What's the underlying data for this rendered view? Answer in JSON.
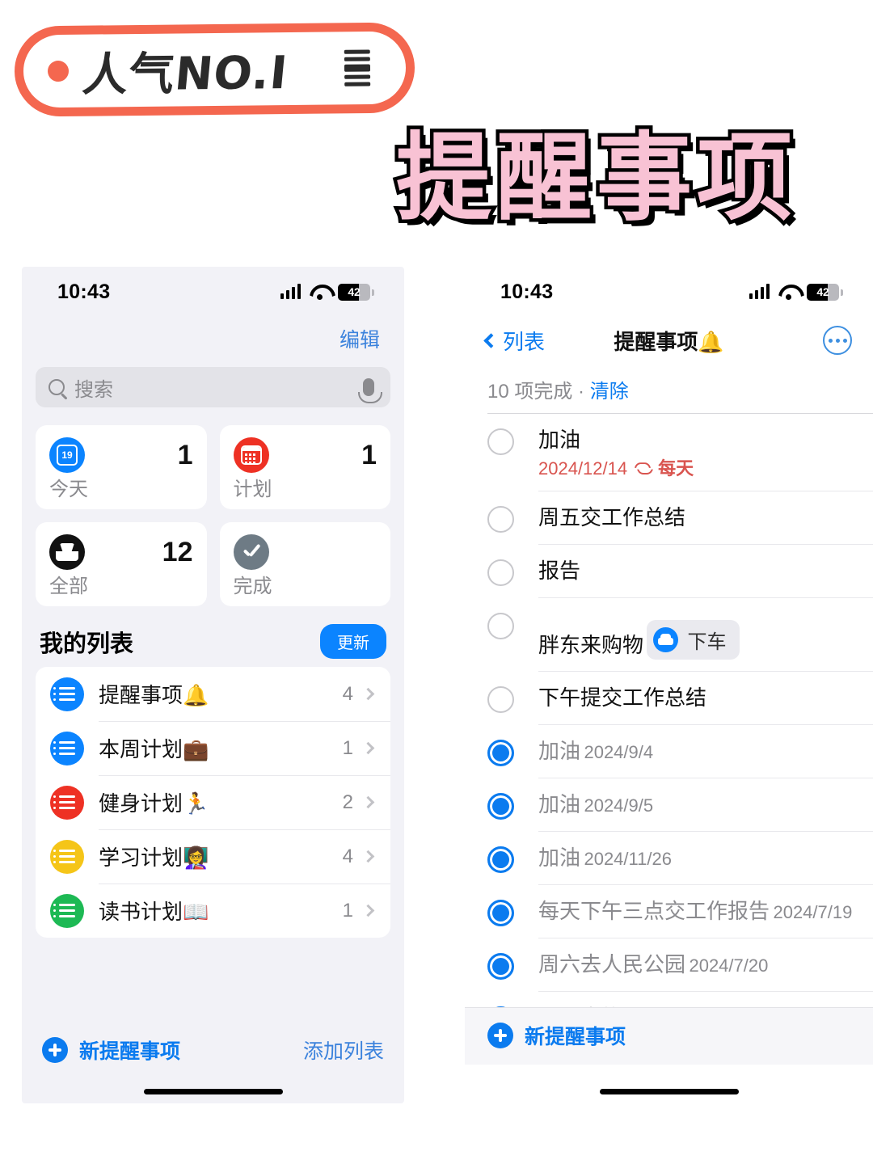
{
  "decor": {
    "badge_text": "人气NO.I",
    "badge_color": "#F4674F",
    "title": "提醒事项",
    "title_fill": "#F8C2D4",
    "title_stroke": "#000000"
  },
  "status_bar": {
    "time": "10:43",
    "battery": "42",
    "signal_icon": "cellular-signal-icon",
    "wifi_icon": "wifi-icon",
    "battery_icon": "battery-icon"
  },
  "left_phone": {
    "edit_label": "编辑",
    "search": {
      "placeholder": "搜索",
      "icon": "search-icon",
      "mic_icon": "microphone-icon"
    },
    "smart_lists": [
      {
        "label": "今天",
        "count": "1",
        "icon": "calendar-day-icon",
        "color": "#0B84FF"
      },
      {
        "label": "计划",
        "count": "1",
        "icon": "calendar-grid-icon",
        "color": "#EE3124"
      },
      {
        "label": "全部",
        "count": "12",
        "icon": "inbox-tray-icon",
        "color": "#111111"
      },
      {
        "label": "完成",
        "count": "",
        "icon": "checkmark-icon",
        "color": "#6E7B85"
      }
    ],
    "my_lists_title": "我的列表",
    "update_label": "更新",
    "lists": [
      {
        "label": "提醒事项🔔",
        "count": "4",
        "color": "#0B84FF"
      },
      {
        "label": "本周计划💼",
        "count": "1",
        "color": "#0B84FF"
      },
      {
        "label": "健身计划🏃",
        "count": "2",
        "color": "#EE3124"
      },
      {
        "label": "学习计划👩‍🏫",
        "count": "4",
        "color": "#F5C518"
      },
      {
        "label": "读书计划📖",
        "count": "1",
        "color": "#1DB954"
      }
    ],
    "toolbar": {
      "new_reminder": "新提醒事项",
      "add_list": "添加列表",
      "plus_icon": "plus-circle-icon"
    }
  },
  "right_phone": {
    "back_label": "列表",
    "back_icon": "chevron-left-icon",
    "nav_title": "提醒事项🔔",
    "more_icon": "ellipsis-circle-icon",
    "completed_summary": "10 项完成 · ",
    "clear_label": "清除",
    "reminders": [
      {
        "title": "加油",
        "sub": "2024/12/14",
        "repeat": "每天",
        "done": false,
        "overdue": true
      },
      {
        "title": "周五交工作总结",
        "sub": "",
        "done": false
      },
      {
        "title": "报告",
        "sub": "",
        "done": false
      },
      {
        "title": "胖东来购物",
        "sub": "",
        "done": false,
        "tag": "下车",
        "tag_icon": "car-icon"
      },
      {
        "title": "下午提交工作总结",
        "sub": "",
        "done": false
      },
      {
        "title": "加油",
        "sub": "2024/9/4",
        "done": true
      },
      {
        "title": "加油",
        "sub": "2024/9/5",
        "done": true
      },
      {
        "title": "加油",
        "sub": "2024/11/26",
        "done": true
      },
      {
        "title": "每天下午三点交工作报告",
        "sub": "2024/7/19",
        "done": true
      },
      {
        "title": "周六去人民公园",
        "sub": "2024/7/20",
        "done": true
      },
      {
        "title": "周五去找下王总",
        "sub": "",
        "done": true
      }
    ],
    "toolbar": {
      "new_reminder": "新提醒事项",
      "plus_icon": "plus-circle-icon"
    }
  }
}
